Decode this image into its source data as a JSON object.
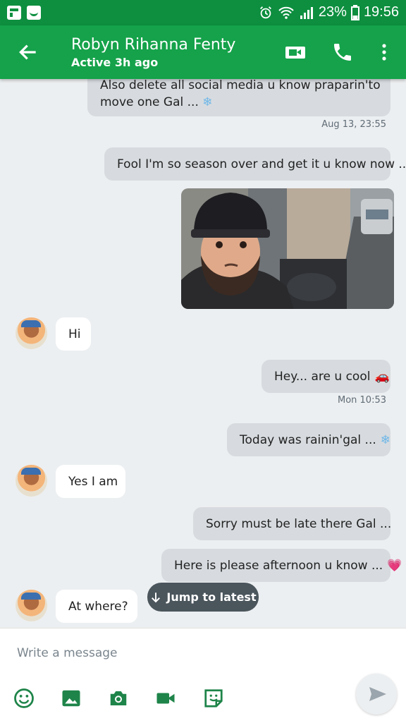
{
  "status_bar": {
    "battery": "23%",
    "time": "19:56"
  },
  "header": {
    "contact_name": "Robyn Rihanna Fenty",
    "presence": "Active 3h ago"
  },
  "messages": [
    {
      "direction": "out",
      "text": "Also delete all social media u know praparin'to",
      "text2": "move one Gal ...",
      "emoji": "❄"
    },
    {
      "type": "timestamp",
      "text": "Aug 13, 23:55"
    },
    {
      "direction": "out",
      "text": "Fool I'm so season over and get it u know now ..."
    },
    {
      "direction": "out",
      "type": "photo"
    },
    {
      "direction": "in",
      "text": "Hi"
    },
    {
      "direction": "out",
      "text": "Hey... are u cool",
      "emoji": "🚗"
    },
    {
      "type": "timestamp",
      "text": "Mon 10:53"
    },
    {
      "direction": "out",
      "text": "Today was rainin'gal ...",
      "emoji": "❄"
    },
    {
      "direction": "in",
      "text": "Yes I am"
    },
    {
      "direction": "out",
      "text": "Sorry must be late there Gal ..."
    },
    {
      "direction": "out",
      "text": "Here is please afternoon u know ...",
      "emoji": "💗"
    },
    {
      "direction": "in",
      "text": "At where?"
    }
  ],
  "jump_button": "Jump to latest",
  "composer": {
    "placeholder": "Write a message"
  },
  "colors": {
    "status_bar": "#0d8f3f",
    "app_bar": "#15a24a",
    "tool_icon": "#1e8449"
  }
}
